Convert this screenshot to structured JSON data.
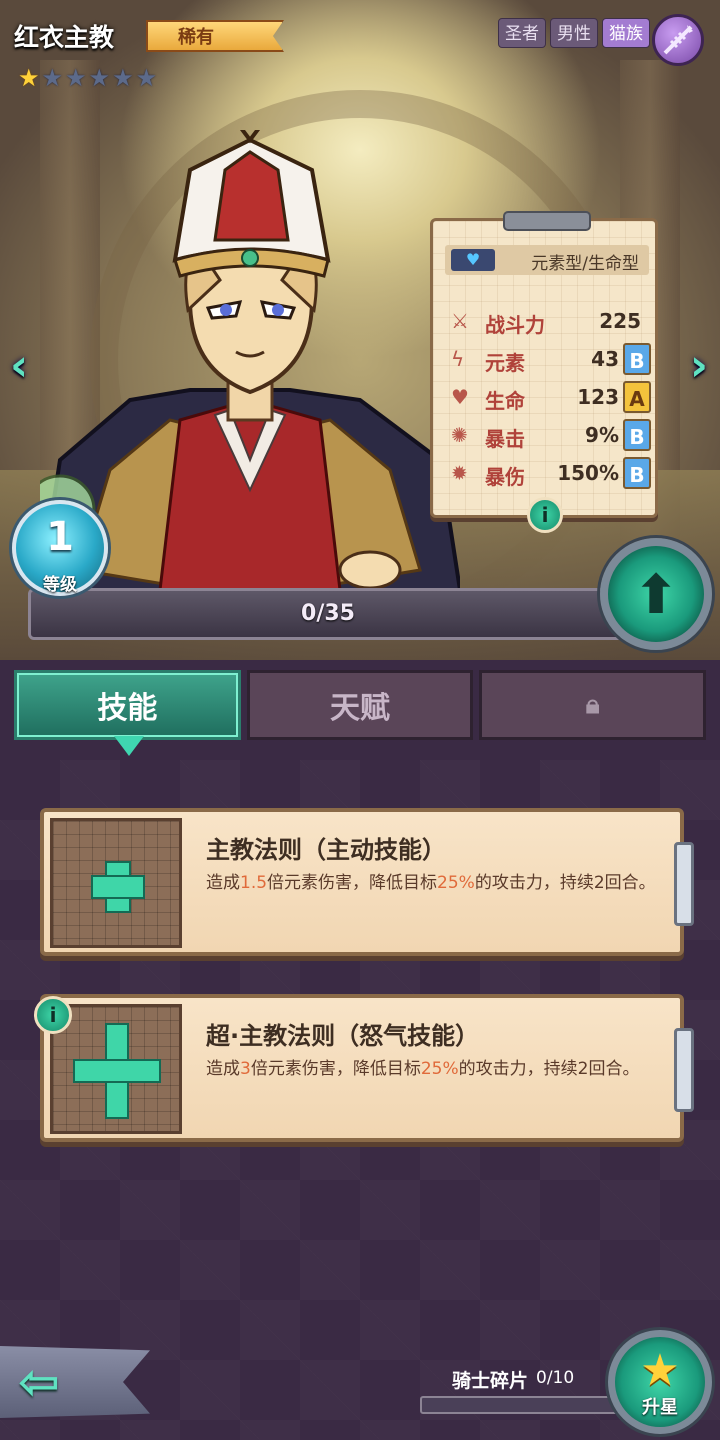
{
  "hero": {
    "name": "红衣主教",
    "rarity": "稀有",
    "stars_filled": 1,
    "stars_total": 6,
    "tags": [
      "圣者",
      "男性",
      "猫族"
    ],
    "race_icon": "fish-bone-icon"
  },
  "stats": {
    "type": "元素型/生命型",
    "rows": [
      {
        "icon": "combat-power-icon",
        "label": "战斗力",
        "value": "225",
        "grade": ""
      },
      {
        "icon": "element-icon",
        "label": "元素",
        "value": "43",
        "grade": "B"
      },
      {
        "icon": "heart-icon",
        "label": "生命",
        "value": "123",
        "grade": "A"
      },
      {
        "icon": "crit-icon",
        "label": "暴击",
        "value": "9%",
        "grade": "B"
      },
      {
        "icon": "crit-damage-icon",
        "label": "暴伤",
        "value": "150%",
        "grade": "B"
      }
    ],
    "info": "i"
  },
  "level": {
    "value": "1",
    "label": "等级",
    "exp_text": "0/35",
    "exp_fraction": 0
  },
  "tabs": [
    {
      "label": "技能",
      "active": true
    },
    {
      "label": "天赋",
      "active": false
    },
    {
      "label": "",
      "locked": true
    }
  ],
  "skills": [
    {
      "title": "主教法则（主动技能）",
      "desc_parts": [
        "造成",
        "1.5",
        "倍元素伤害，降低目标",
        "25%",
        "的攻击力，持续2回合。"
      ]
    },
    {
      "title": "超·主教法则（怒气技能）",
      "desc_parts": [
        "造成",
        "3",
        "倍元素伤害，降低目标",
        "25%",
        "的攻击力，持续2回合。"
      ]
    }
  ],
  "bottom": {
    "shard_label": "骑士碎片",
    "shard_count": "0/10",
    "star_up_label": "升星"
  },
  "colors": {
    "accent": "#3fd6a8",
    "rarity": "#f4b84a",
    "grade_b": "#5aa8e8",
    "grade_a": "#f4c33c"
  }
}
